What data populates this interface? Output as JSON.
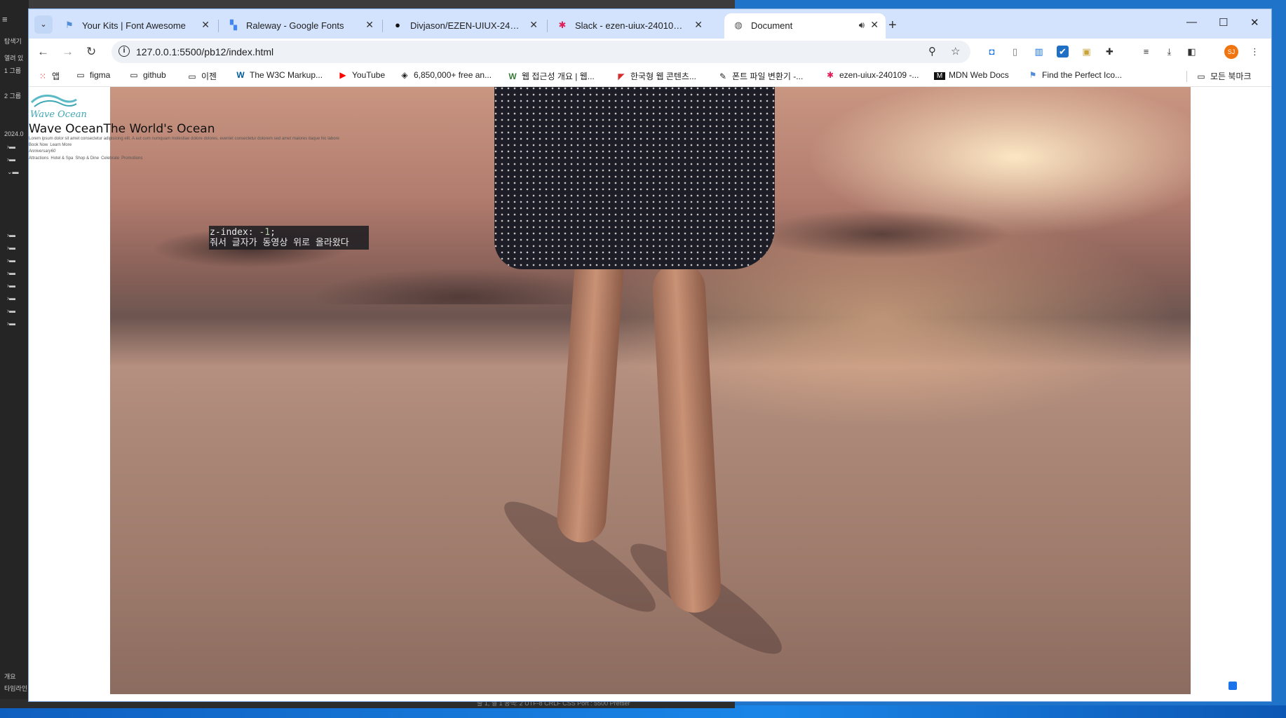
{
  "browser": {
    "tabs": [
      {
        "title": "Your Kits | Font Awesome",
        "icon": "flag-icon",
        "icon_color": "#528dd7"
      },
      {
        "title": "Raleway - Google Fonts",
        "icon": "google-fonts-icon",
        "icon_color": "#4285f4"
      },
      {
        "title": "Divjason/EZEN-UIUX-240109",
        "icon": "github-icon",
        "icon_color": "#111111"
      },
      {
        "title": "Slack - ezen-uiux-240109 - W…",
        "icon": "slack-icon",
        "icon_color": "#e01e5a"
      },
      {
        "title": "Document",
        "icon": "globe-icon",
        "icon_color": "#555555",
        "active": true,
        "audio": true
      }
    ],
    "url": "127.0.0.1:5500/pb12/index.html",
    "profile_initials": "SJ",
    "bookmarks": [
      {
        "label": "앱",
        "icon": "apps-grid-icon"
      },
      {
        "label": "figma",
        "icon": "folder-icon"
      },
      {
        "label": "github",
        "icon": "folder-icon"
      },
      {
        "label": "이젠",
        "icon": "folder-icon"
      },
      {
        "label": "The W3C Markup...",
        "icon": "w3c-icon"
      },
      {
        "label": "YouTube",
        "icon": "youtube-icon"
      },
      {
        "label": "6,850,000+ free an...",
        "icon": "freepik-icon"
      },
      {
        "label": "웹 접근성 개요 | 웹...",
        "icon": "w-icon"
      },
      {
        "label": "한국형 웹 콘텐츠...",
        "icon": "pdf-icon"
      },
      {
        "label": "폰트 파일 변환기 -...",
        "icon": "wrench-icon"
      },
      {
        "label": "ezen-uiux-240109 -...",
        "icon": "slack-icon"
      },
      {
        "label": "MDN Web Docs",
        "icon": "mdn-icon"
      },
      {
        "label": "Find the Perfect Ico...",
        "icon": "flag-icon"
      },
      {
        "label": "모든 북마크",
        "icon": "folder-icon"
      }
    ]
  },
  "page": {
    "logo_text": "Wave Ocean",
    "title": "Wave OceanThe World's Ocean",
    "paragraph": "Lorem ipsum dolor sit amet consectetur adipisicing elit. A aut cum numquam molestiae dolore dolores, eveniet consectetur dolorem sed amet maiores itaque hic labore",
    "buttons": [
      "Book Now",
      "Learn More"
    ],
    "anniversary": "Anniversary60",
    "nav_links": [
      "Attractions",
      "Hotel & Spa",
      "Shop & Dine",
      "Celebrate",
      "Promotions"
    ]
  },
  "note": {
    "line1_prefix": "z-index: ",
    "line1_value": "-1",
    "line1_suffix": ";",
    "line2": "줘서 글자가 동영상 위로 올라왔다"
  },
  "vscode": {
    "explorer_labels": [
      "탐색기",
      "열려 있",
      "1 그룹",
      "2 그룹",
      "2024.0"
    ],
    "bottom_labels": [
      "개요",
      "타임라인"
    ],
    "status_text": "줄 1, 열 1  공백: 2  UTF-8  CRLF  CSS  Port : 5500  Prettier"
  },
  "colors": {
    "tabstrip": "#d3e3fd",
    "logo": "#3fa7b4",
    "profile": "#f0740f"
  }
}
